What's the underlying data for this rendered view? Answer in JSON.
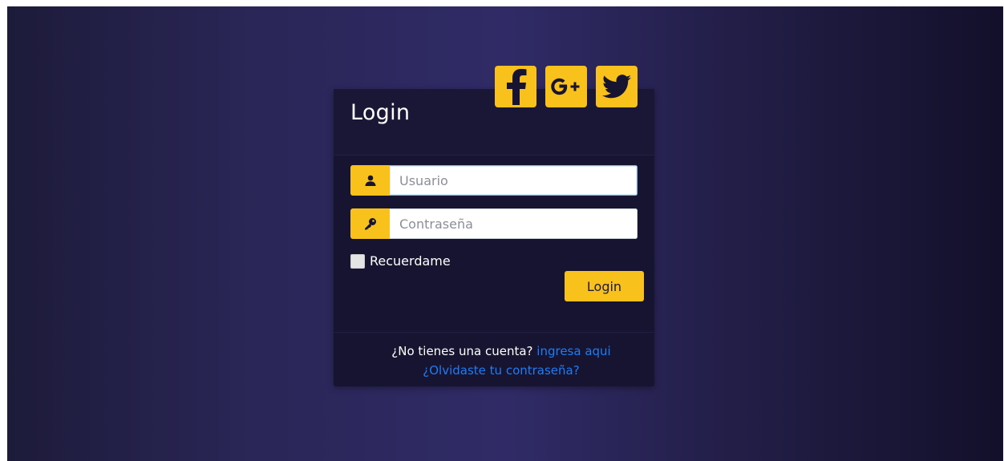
{
  "login": {
    "title": "Login",
    "social": [
      {
        "name": "facebook-icon"
      },
      {
        "name": "google-plus-icon"
      },
      {
        "name": "twitter-icon"
      }
    ],
    "username_placeholder": "Usuario",
    "password_placeholder": "Contraseña",
    "remember_label": "Recuerdame",
    "login_button": "Login",
    "no_account_text": "¿No tienes una cuenta?",
    "register_link": "ingresa aqui",
    "forgot_link": "¿Olvidaste tu contraseña?"
  },
  "colors": {
    "accent": "#f9c11b",
    "card": "#171431",
    "link": "#1e7cf4",
    "background_mid": "#302b66"
  }
}
